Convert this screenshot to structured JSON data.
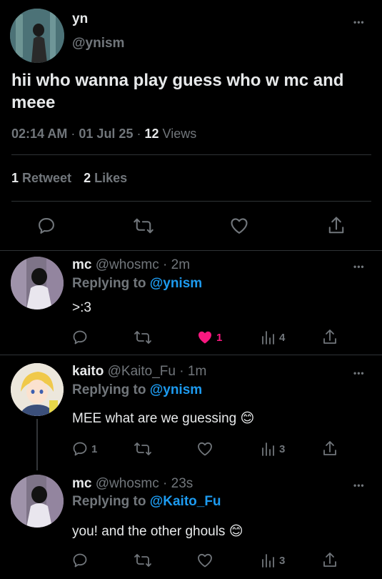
{
  "main_tweet": {
    "display_name": "yn",
    "handle": "@ynism",
    "text": "hii who wanna play guess who w mc and meee",
    "time": "02:14 AM",
    "date": "01 Jul 25",
    "views_count": "12",
    "views_label": "Views",
    "retweets_count": "1",
    "retweets_label": "Retweet",
    "likes_count": "2",
    "likes_label": "Likes"
  },
  "replies": [
    {
      "display_name": "mc",
      "handle": "@whosmc",
      "age": "2m",
      "replying_label": "Replying to",
      "replying_to": "@ynism",
      "text": ">:3",
      "likes": "1",
      "liked": true,
      "views": "4"
    },
    {
      "display_name": "kaito",
      "handle": "@Kaito_Fu",
      "age": "1m",
      "replying_label": "Replying to",
      "replying_to": "@ynism",
      "text": "MEE what are we guessing 😊",
      "replies": "1",
      "views": "3"
    },
    {
      "display_name": "mc",
      "handle": "@whosmc",
      "age": "23s",
      "replying_label": "Replying to",
      "replying_to": "@Kaito_Fu",
      "text": "you! and the other ghouls 😊",
      "views": "3"
    }
  ],
  "separator": "·",
  "more_icon": "•••",
  "colors": {
    "background": "#000000",
    "text": "#e7e9ea",
    "muted": "#71767b",
    "link": "#1d9bf0",
    "like_active": "#f91880",
    "divider": "#2f3336"
  },
  "icons": [
    "reply-icon",
    "retweet-icon",
    "like-icon",
    "share-icon",
    "views-icon",
    "more-icon"
  ]
}
